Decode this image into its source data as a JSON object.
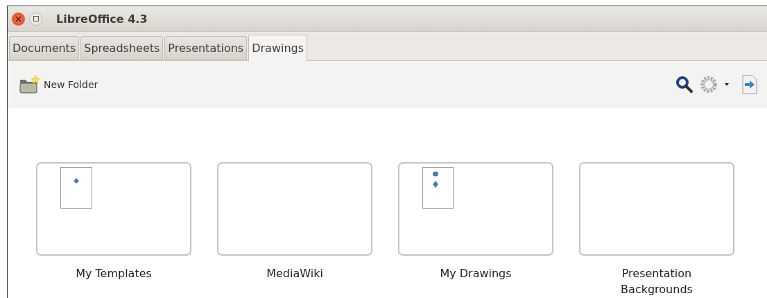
{
  "window": {
    "title": "LibreOffice 4.3"
  },
  "tabs": [
    {
      "label": "Documents",
      "selected": false
    },
    {
      "label": "Spreadsheets",
      "selected": false
    },
    {
      "label": "Presentations",
      "selected": false
    },
    {
      "label": "Drawings",
      "selected": true
    }
  ],
  "toolbar": {
    "new_folder": "New Folder"
  },
  "folders": [
    {
      "name": "My Templates",
      "kind": "one-shape"
    },
    {
      "name": "MediaWiki",
      "kind": "empty"
    },
    {
      "name": "My Drawings",
      "kind": "two-shapes"
    },
    {
      "name": "Presentation Backgrounds",
      "kind": "empty"
    }
  ]
}
